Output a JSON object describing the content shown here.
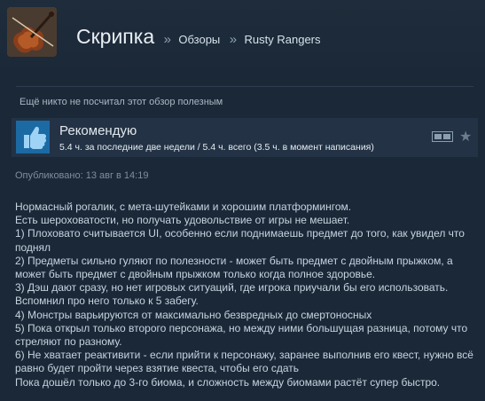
{
  "header": {
    "game_title": "Скрипка",
    "separator": "»",
    "breadcrumb_reviews": "Обзоры",
    "breadcrumb_user": "Rusty Rangers"
  },
  "helpful_text": "Ещё никто не посчитал этот обзор полезным",
  "recommendation": {
    "label": "Рекомендую",
    "hours": "5.4 ч. за последние две недели / 5.4 ч. всего (3.5 ч. в момент написания)"
  },
  "posted": "Опубликовано: 13 авг в 14:19",
  "review_lines": [
    "Нормасный рогалик, с мета-шутейками и хорошим платформингом.",
    "Есть шероховатости, но получать удовольствие от игры не мешает.",
    "1) Плоховато считывается UI, особенно если поднимаешь предмет до того, как увидел что",
    "поднял",
    "2) Предметы сильно гуляют по полезности - может быть предмет с двойным прыжком, а",
    "может быть предмет с двойным прыжком только когда полное здоровье.",
    "3) Дэш дают сразу, но нет игровых ситуаций, где игрока приучали бы его использовать.",
    "Вспомнил про него только к 5 забегу.",
    "4) Монстры варьируются от максимально безвредных до смертоносных",
    "5) Пока открыл только второго персонажа, но между ними большущая разница, потому что",
    "стреляют по разному.",
    "6) Не хватает реактивити - если прийти к персонажу, заранее выполнив его квест, нужно всё",
    "равно будет пройти через взятие квеста, чтобы его сдать",
    "Пока дошёл только до 3-го биома, и сложность между биомами растёт супер быстро."
  ],
  "colors": {
    "background": "#1b2838",
    "recommend_box": "#233245",
    "thumb_bg": "#1b6aa4",
    "text": "#c6d4df"
  },
  "icons": {
    "avatar": "violin-image",
    "thumb": "thumbs-up-icon",
    "film": "film-strip-icon",
    "star": "star-icon"
  }
}
